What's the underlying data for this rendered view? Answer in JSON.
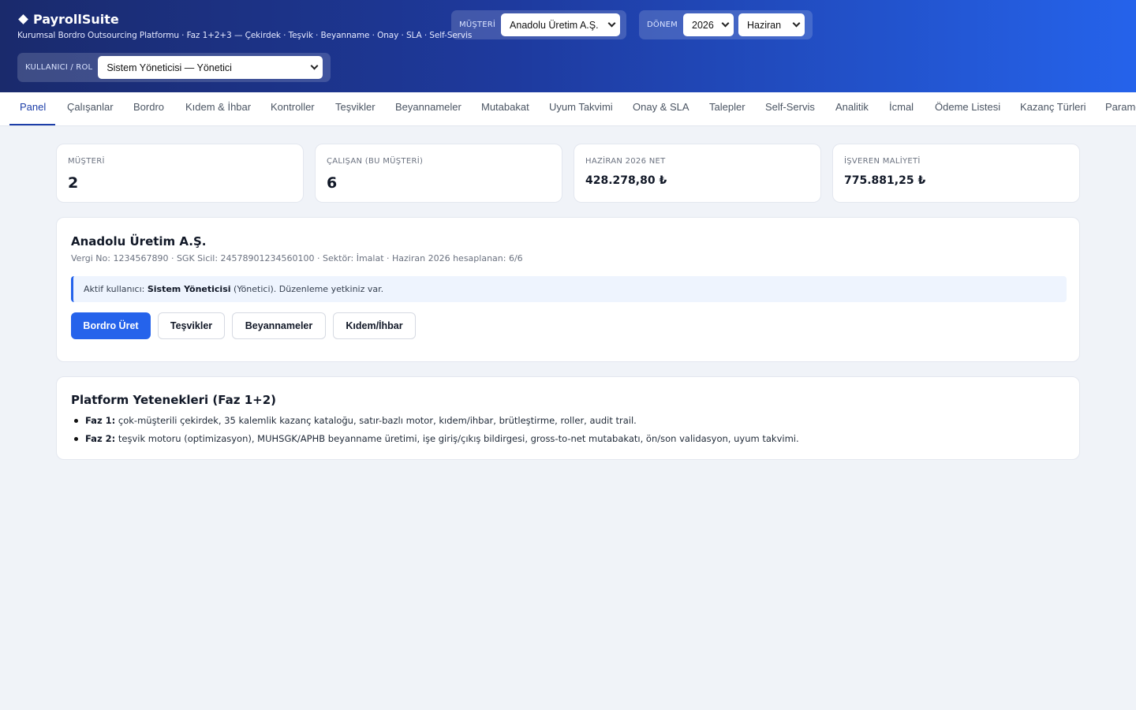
{
  "app": {
    "title": "PayrollSuite",
    "subtitle": "Kurumsal Bordro Outsourcing Platformu · Faz 1+2+3 — Çekirdek · Teşvik · Beyanname · Onay · SLA · Self-Servis"
  },
  "controls": {
    "client_label": "MÜŞTERİ",
    "client_value": "Anadolu Üretim A.Ş.",
    "period_label": "DÖNEM",
    "year_value": "2026",
    "month_value": "Haziran",
    "user_label": "KULLANICI / ROL",
    "user_value": "Sistem Yöneticisi — Yönetici"
  },
  "nav": {
    "tabs": [
      {
        "label": "Panel",
        "active": true
      },
      {
        "label": "Çalışanlar"
      },
      {
        "label": "Bordro"
      },
      {
        "label": "Kıdem & İhbar"
      },
      {
        "label": "Kontroller"
      },
      {
        "label": "Teşvikler"
      },
      {
        "label": "Beyannameler"
      },
      {
        "label": "Mutabakat"
      },
      {
        "label": "Uyum Takvimi"
      },
      {
        "label": "Onay & SLA"
      },
      {
        "label": "Talepler"
      },
      {
        "label": "Self-Servis"
      },
      {
        "label": "Analitik"
      },
      {
        "label": "İcmal"
      },
      {
        "label": "Ödeme Listesi"
      },
      {
        "label": "Kazanç Türleri"
      },
      {
        "label": "Parame"
      }
    ]
  },
  "kpis": [
    {
      "label": "MÜŞTERİ",
      "value": "2"
    },
    {
      "label": "ÇALIŞAN (BU MÜŞTERİ)",
      "value": "6"
    },
    {
      "label": "HAZİRAN 2026 NET",
      "value": "428.278,80 ₺"
    },
    {
      "label": "İŞVEREN MALİYETİ",
      "value": "775.881,25 ₺"
    }
  ],
  "client_card": {
    "name": "Anadolu Üretim A.Ş.",
    "meta": "Vergi No: 1234567890 · SGK Sicil: 24578901234560100 · Sektör: İmalat · Haziran 2026 hesaplanan: 6/6",
    "info_prefix": "Aktif kullanıcı: ",
    "info_user": "Sistem Yöneticisi",
    "info_suffix": " (Yönetici). Düzenleme yetkiniz var.",
    "buttons": [
      "Bordro Üret",
      "Teşvikler",
      "Beyannameler",
      "Kıdem/İhbar"
    ]
  },
  "capabilities": {
    "title": "Platform Yetenekleri (Faz 1+2)",
    "items": [
      {
        "label": "Faz 1:",
        "text": " çok-müşterili çekirdek, 35 kalemlik kazanç kataloğu, satır-bazlı motor, kıdem/ihbar, brütleştirme, roller, audit trail."
      },
      {
        "label": "Faz 2:",
        "text": " teşvik motoru (optimizasyon), MUHSGK/APHB beyanname üretimi, işe giriş/çıkış bildirgesi, gross-to-net mutabakatı, ön/son validasyon, uyum takvimi."
      }
    ]
  }
}
